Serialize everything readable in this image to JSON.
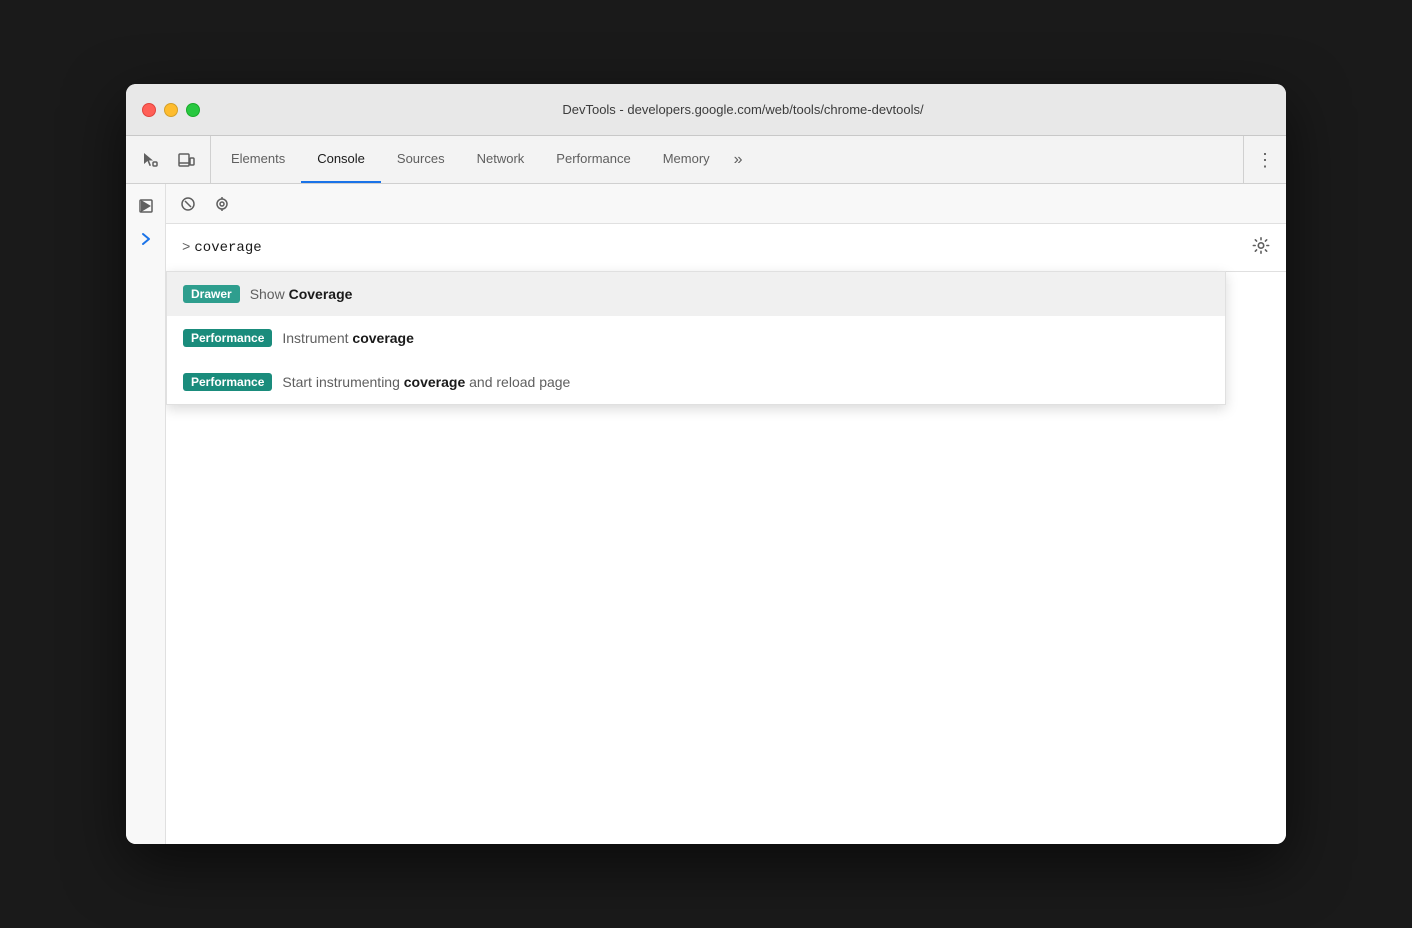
{
  "window": {
    "title": "DevTools - developers.google.com/web/tools/chrome-devtools/"
  },
  "trafficLights": {
    "close": "close",
    "minimize": "minimize",
    "maximize": "maximize"
  },
  "tabs": [
    {
      "id": "elements",
      "label": "Elements",
      "active": false
    },
    {
      "id": "console",
      "label": "Console",
      "active": true
    },
    {
      "id": "sources",
      "label": "Sources",
      "active": false
    },
    {
      "id": "network",
      "label": "Network",
      "active": false
    },
    {
      "id": "performance",
      "label": "Performance",
      "active": false
    },
    {
      "id": "memory",
      "label": "Memory",
      "active": false
    }
  ],
  "toolbar": {
    "moreLabel": "»",
    "kebabLabel": "⋮"
  },
  "console": {
    "inputValue": ">coverage",
    "settingsTooltip": "Settings"
  },
  "autocomplete": {
    "items": [
      {
        "badgeText": "Drawer",
        "badgeClass": "badge-drawer",
        "textBefore": "Show ",
        "textBold": "Coverage",
        "textAfter": ""
      },
      {
        "badgeText": "Performance",
        "badgeClass": "badge-performance",
        "textBefore": "Instrument ",
        "textBold": "coverage",
        "textAfter": ""
      },
      {
        "badgeText": "Performance",
        "badgeClass": "badge-performance",
        "textBefore": "Start instrumenting ",
        "textBold": "coverage",
        "textAfter": " and reload page"
      }
    ]
  },
  "sidebar": {
    "inspectLabel": "►",
    "deviceLabel": "⊡",
    "chevronLabel": "›"
  }
}
